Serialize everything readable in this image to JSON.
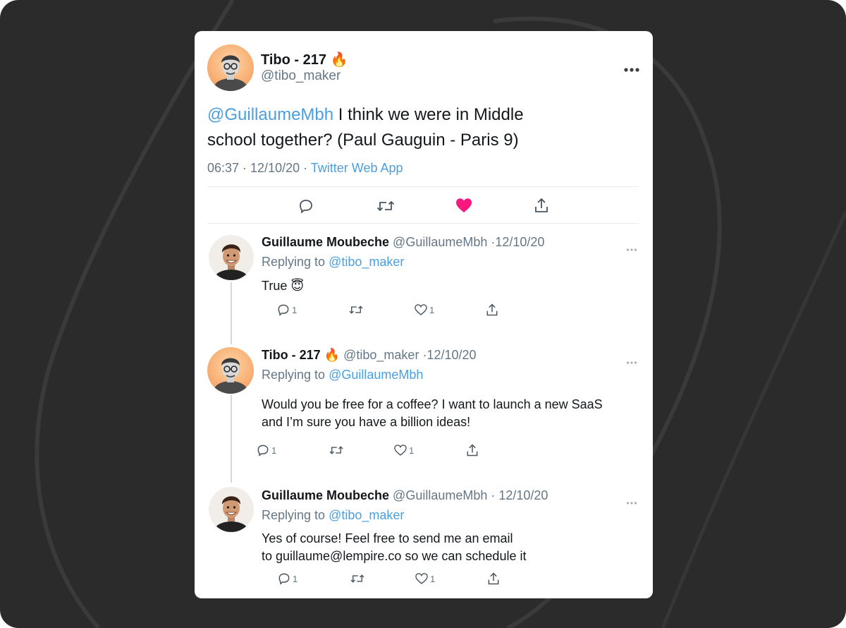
{
  "colors": {
    "background": "#2b2b2b",
    "card": "#ffffff",
    "link": "#4a9fe0",
    "muted": "#657786",
    "like_active": "#f91880"
  },
  "main_tweet": {
    "display_name": "Tibo - 217 🔥",
    "handle": "@tibo_maker",
    "mention": "@GuillaumeMbh",
    "text_line1": " I think we were in Middle",
    "text_line2": "school together? (Paul Gauguin - Paris 9)",
    "timestamp": "06:37 · 12/10/20 · ",
    "source": "Twitter Web App",
    "more_icon": "more-horizontal-icon",
    "actions": [
      "reply-icon",
      "retweet-icon",
      "like-icon-filled",
      "share-icon"
    ]
  },
  "replies": [
    {
      "display_name": "Guillaume Moubeche",
      "handle_date": "@GuillaumeMbh ·12/10/20",
      "replying_prefix": "Replying to ",
      "replying_to": "@tibo_maker",
      "text_lines": [
        "True 😇"
      ],
      "reply_count": "1",
      "like_count": "1"
    },
    {
      "display_name": "Tibo - 217 🔥",
      "handle_date": "@tibo_maker ·12/10/20",
      "replying_prefix": "Replying to ",
      "replying_to": "@GuillaumeMbh",
      "text_lines": [
        "Would you be free for a coffee? I want to launch a new SaaS",
        "and I’m sure you have a billion ideas!"
      ],
      "reply_count": "1",
      "like_count": "1"
    },
    {
      "display_name": "Guillaume Moubeche",
      "handle_date": "@GuillaumeMbh · 12/10/20",
      "replying_prefix": "Replying to ",
      "replying_to": "@tibo_maker",
      "text_lines": [
        "Yes of course! Feel free to send me an email",
        "to guillaume@lempire.co so we can schedule it"
      ],
      "reply_count": "1",
      "like_count": "1"
    }
  ]
}
